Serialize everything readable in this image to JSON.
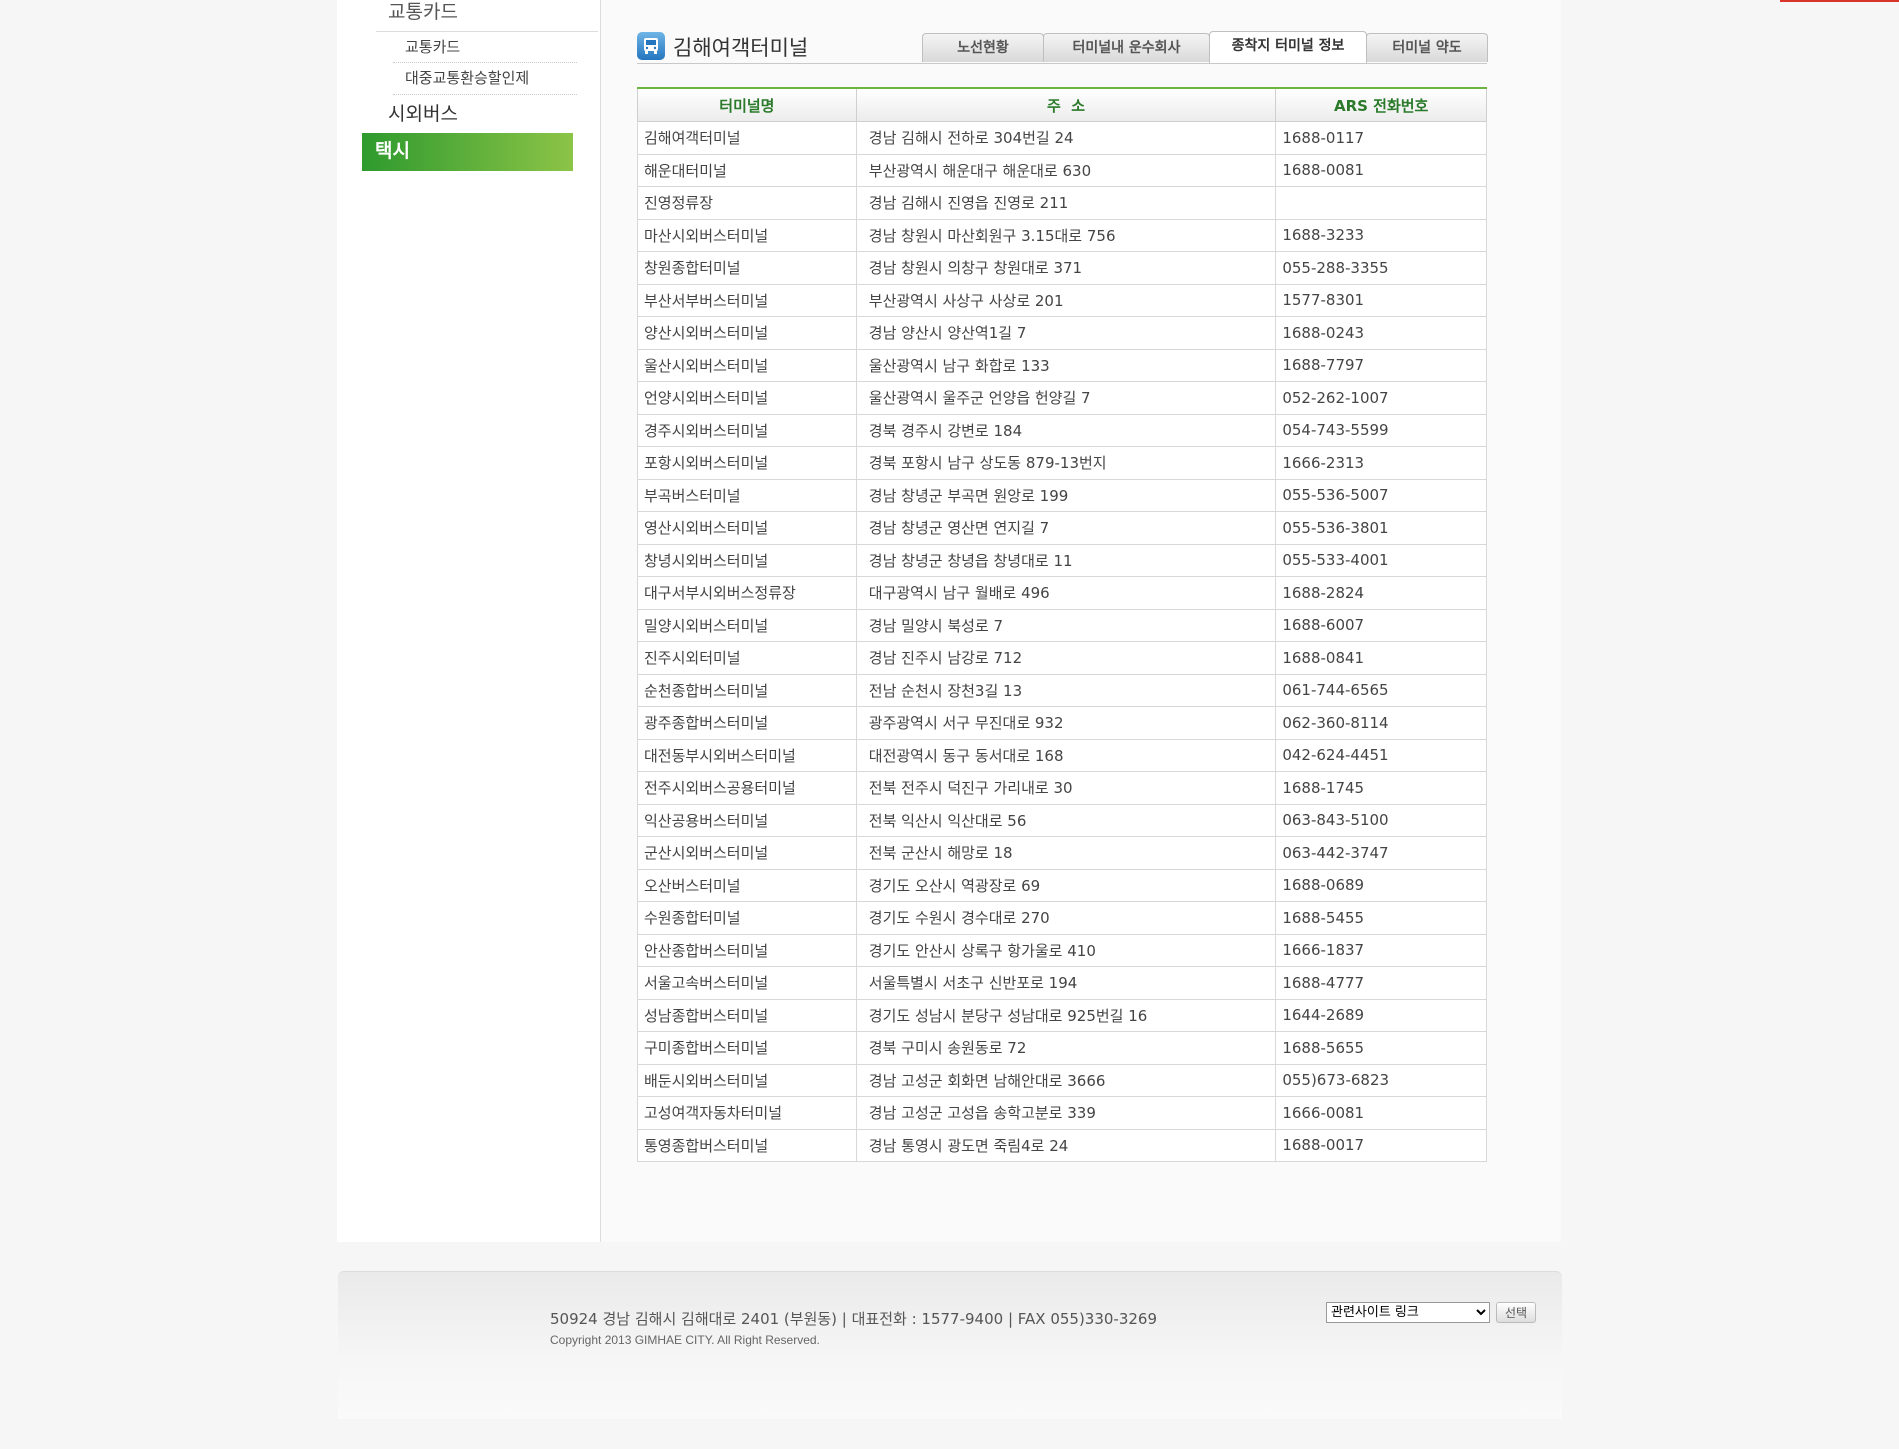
{
  "sidebar": {
    "group1": "교통카드",
    "sub_items": [
      "교통카드",
      "대중교통환승할인제"
    ],
    "item2": "시외버스",
    "active": "택시"
  },
  "header": {
    "title": "김해여객터미널",
    "tabs": [
      "노선현황",
      "터미널내 운수회사",
      "종착지 터미널 정보",
      "터미널 약도"
    ],
    "active_tab_index": 2
  },
  "table": {
    "headers": [
      "터미널명",
      "주  소",
      "ARS 전화번호"
    ],
    "rows": [
      [
        "김해여객터미널",
        "경남 김해시 전하로 304번길 24",
        "1688-0117"
      ],
      [
        "해운대터미널",
        "부산광역시 해운대구 해운대로 630",
        "1688-0081"
      ],
      [
        "진영정류장",
        "경남 김해시 진영읍 진영로 211",
        ""
      ],
      [
        "마산시외버스터미널",
        "경남 창원시 마산회원구 3.15대로 756",
        "1688-3233"
      ],
      [
        "창원종합터미널",
        "경남 창원시 의창구 창원대로 371",
        "055-288-3355"
      ],
      [
        "부산서부버스터미널",
        "부산광역시 사상구 사상로 201",
        "1577-8301"
      ],
      [
        "양산시외버스터미널",
        "경남 양산시 양산역1길 7",
        "1688-0243"
      ],
      [
        "울산시외버스터미널",
        "울산광역시 남구 화합로 133",
        "1688-7797"
      ],
      [
        "언양시외버스터미널",
        "울산광역시 울주군 언양읍 헌양길 7",
        "052-262-1007"
      ],
      [
        "경주시외버스터미널",
        "경북 경주시 강변로 184",
        "054-743-5599"
      ],
      [
        "포항시외버스터미널",
        "경북 포항시 남구 상도동 879-13번지",
        "1666-2313"
      ],
      [
        "부곡버스터미널",
        "경남 창녕군 부곡면 원앙로 199",
        "055-536-5007"
      ],
      [
        "영산시외버스터미널",
        "경남 창녕군 영산면 연지길 7",
        "055-536-3801"
      ],
      [
        "창녕시외버스터미널",
        "경남 창녕군 창녕읍 창녕대로 11",
        "055-533-4001"
      ],
      [
        "대구서부시외버스정류장",
        "대구광역시 남구 월배로 496",
        "1688-2824"
      ],
      [
        "밀양시외버스터미널",
        "경남 밀양시 북성로 7",
        "1688-6007"
      ],
      [
        "진주시외터미널",
        "경남 진주시 남강로 712",
        "1688-0841"
      ],
      [
        "순천종합버스터미널",
        "전남 순천시 장천3길 13",
        "061-744-6565"
      ],
      [
        "광주종합버스터미널",
        "광주광역시 서구 무진대로 932",
        "062-360-8114"
      ],
      [
        "대전동부시외버스터미널",
        "대전광역시 동구 동서대로 168",
        "042-624-4451"
      ],
      [
        "전주시외버스공용터미널",
        "전북 전주시 덕진구 가리내로 30",
        "1688-1745"
      ],
      [
        "익산공용버스터미널",
        "전북 익산시 익산대로 56",
        "063-843-5100"
      ],
      [
        "군산시외버스터미널",
        "전북 군산시 해망로 18",
        "063-442-3747"
      ],
      [
        "오산버스터미널",
        "경기도 오산시 역광장로 69",
        "1688-0689"
      ],
      [
        "수원종합터미널",
        "경기도 수원시 경수대로 270",
        "1688-5455"
      ],
      [
        "안산종합버스터미널",
        "경기도 안산시 상록구 항가울로 410",
        "1666-1837"
      ],
      [
        "서울고속버스터미널",
        "서울특별시 서초구 신반포로 194",
        "1688-4777"
      ],
      [
        "성남종합버스터미널",
        "경기도 성남시 분당구 성남대로 925번길 16",
        "1644-2689"
      ],
      [
        "구미종합버스터미널",
        "경북 구미시 송원동로 72",
        "1688-5655"
      ],
      [
        "배둔시외버스터미널",
        "경남 고성군 회화면 남해안대로 3666",
        "055)673-6823"
      ],
      [
        "고성여객자동차터미널",
        "경남 고성군 고성읍 송학고분로 339",
        "1666-0081"
      ],
      [
        "통영종합버스터미널",
        "경남 통영시 광도면 죽림4로 24",
        "1688-0017"
      ]
    ]
  },
  "footer": {
    "address": "50924 경남 김해시 김해대로 2401 (부원동) | 대표전화 : 1577-9400 | FAX 055)330-3269",
    "copyright": "Copyright 2013 GIMHAE CITY. All Right Reserved.",
    "select_value": "관련사이트 링크",
    "button_label": "선택"
  },
  "colors": {
    "accent_green": "#6db33f",
    "header_text_green": "#2a7a2a",
    "top_bar_red": "#d9342b"
  }
}
